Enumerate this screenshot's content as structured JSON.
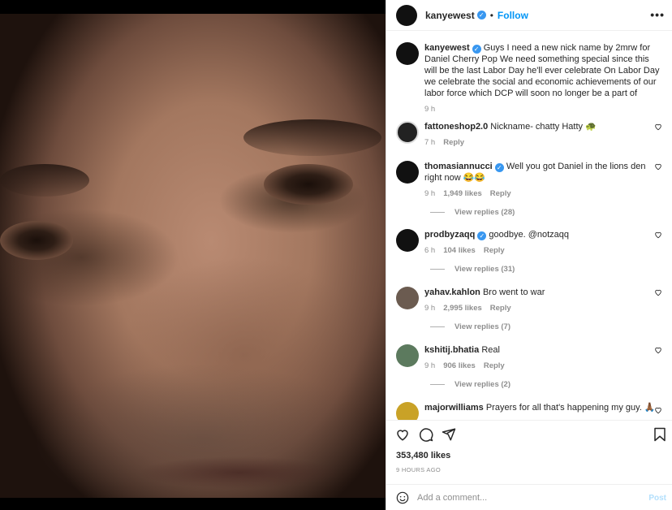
{
  "header": {
    "username": "kanyewest",
    "dot": "•",
    "follow": "Follow",
    "more": "•••"
  },
  "caption": {
    "username": "kanyewest",
    "text": "Guys I need a new nick name by 2mrw for Daniel Cherry Pop We need something special since this will be the last Labor Day he'll ever celebrate On Labor Day we celebrate the social and economic achievements of our labor force which DCP will soon no longer be a part of",
    "time": "9 h"
  },
  "comments": [
    {
      "username": "fattoneshop2.0",
      "text": "Nickname- chatty Hatty 🐢",
      "time": "7 h",
      "likes": "",
      "reply": "Reply",
      "view_replies": ""
    },
    {
      "username": "thomasiannucci",
      "text": "Well you got Daniel in the lions den right now 😂😂",
      "time": "9 h",
      "likes": "1,949 likes",
      "reply": "Reply",
      "view_replies": "View replies (28)"
    },
    {
      "username": "prodbyzaqq",
      "text": "goodbye. @notzaqq",
      "time": "6 h",
      "likes": "104 likes",
      "reply": "Reply",
      "view_replies": "View replies (31)"
    },
    {
      "username": "yahav.kahlon",
      "text": "Bro went to war",
      "time": "9 h",
      "likes": "2,995 likes",
      "reply": "Reply",
      "view_replies": "View replies (7)"
    },
    {
      "username": "kshitij.bhatia",
      "text": "Real",
      "time": "9 h",
      "likes": "906 likes",
      "reply": "Reply",
      "view_replies": "View replies (2)"
    },
    {
      "username": "majorwilliams",
      "text": "Prayers for all that's happening my guy. 🙏🏾"
    }
  ],
  "post": {
    "likes": "353,480 likes",
    "ago": "9 HOURS AGO"
  },
  "composer": {
    "placeholder": "Add a comment...",
    "post": "Post"
  },
  "colors": {
    "accent": "#0095f6",
    "verified": "#3897f0"
  }
}
